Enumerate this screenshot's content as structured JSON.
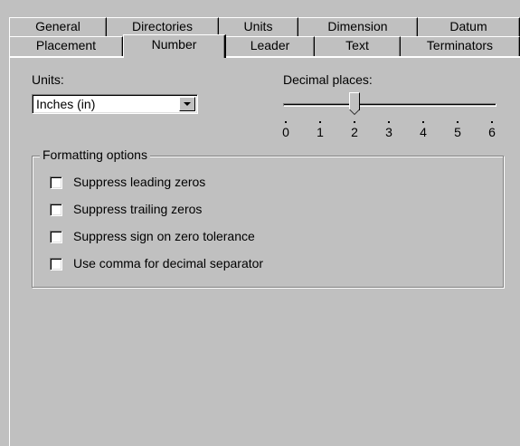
{
  "tabs": {
    "back_row": [
      "General",
      "Directories",
      "Units",
      "Dimension",
      "Datum"
    ],
    "front_row": [
      "Placement",
      "Number",
      "Leader",
      "Text",
      "Terminators"
    ],
    "selected": "Number"
  },
  "units": {
    "label": "Units:",
    "value": "Inches (in)"
  },
  "decimal_places": {
    "label": "Decimal places:",
    "min": 0,
    "max": 6,
    "value": 2,
    "tick_labels": [
      "0",
      "1",
      "2",
      "3",
      "4",
      "5",
      "6"
    ]
  },
  "formatting": {
    "title": "Formatting options",
    "options": [
      {
        "label": "Suppress leading zeros",
        "checked": false
      },
      {
        "label": "Suppress trailing zeros",
        "checked": false
      },
      {
        "label": "Suppress sign on zero tolerance",
        "checked": false
      },
      {
        "label": "Use comma for decimal separator",
        "checked": false
      }
    ]
  }
}
